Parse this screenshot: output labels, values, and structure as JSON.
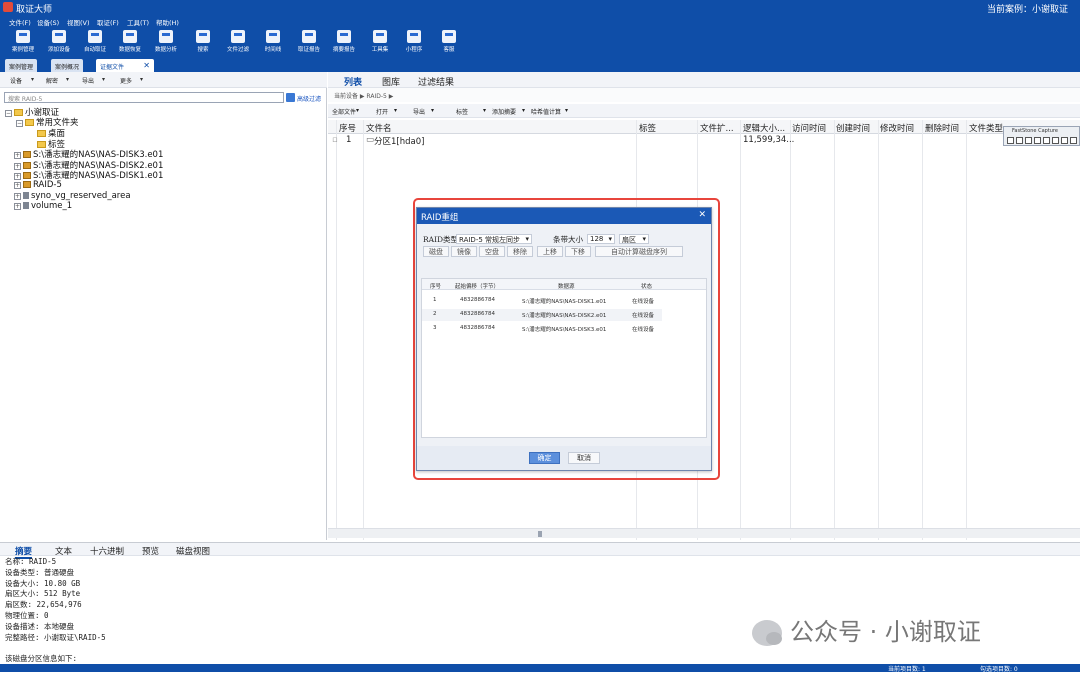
{
  "app": {
    "title": "取证大师",
    "current_case": "当前案例：小谢取证"
  },
  "menu": [
    "文件(F)",
    "设备(S)",
    "视图(V)",
    "取证(F)",
    "工具(T)",
    "帮助(H)"
  ],
  "ribbon": [
    "案例管理",
    "添加设备",
    "自动取证",
    "数据恢复",
    "数据分析",
    "搜索",
    "文件过滤",
    "时间线",
    "取证报告",
    "摘要报告",
    "工具集",
    "小程序",
    "客服"
  ],
  "doc_tabs": [
    "案例管理",
    "案例概况",
    "证据文件"
  ],
  "left": {
    "tool": [
      "设备",
      "解密",
      "导出",
      "更多"
    ],
    "search_placeholder": "搜索 RAID-5",
    "adv_filter": "高级过滤",
    "tree": {
      "root": "小谢取证",
      "common": "常用文件夹",
      "desktop": "桌面",
      "tags": "标签",
      "disk3": "S:\\潘志耀的NAS\\NAS-DISK3.e01",
      "disk2": "S:\\潘志耀的NAS\\NAS-DISK2.e01",
      "disk1": "S:\\潘志耀的NAS\\NAS-DISK1.e01",
      "raid": "RAID-5",
      "syno": "syno_vg_reserved_area",
      "volume": "volume_1"
    }
  },
  "right": {
    "tabs": [
      "列表",
      "图库",
      "过滤结果"
    ],
    "crumb": "当前设备 ▶ RAID-5 ▶",
    "tool": [
      "全部文件",
      "打开",
      "导出",
      "标签",
      "添加摘要",
      "哈希值计算"
    ],
    "columns": [
      "序号",
      "文件名",
      "标签",
      "文件扩...",
      "逻辑大小...",
      "访问时间",
      "创建时间",
      "修改时间",
      "删除时间",
      "文件类型"
    ],
    "row": {
      "index": "1",
      "name": "分区1[hda0]",
      "size": "11,599,34..."
    }
  },
  "faststone": "FastStone Capture",
  "dialog": {
    "title": "RAID重组",
    "raid_type_label": "RAID类型",
    "raid_type_value": "RAID-5 常规左同步",
    "stripe_label": "条带大小",
    "stripe_value": "128",
    "stripe_unit": "扇区",
    "buttons": [
      "磁盘",
      "镜像",
      "空盘",
      "移除",
      "上移",
      "下移",
      "自动计算磁盘序列"
    ],
    "columns": [
      "序号",
      "起始偏移（字节）",
      "数据源",
      "状态"
    ],
    "rows": [
      {
        "no": "1",
        "offset": "4832886784",
        "source": "S:\\潘志耀的NAS\\NAS-DISK1.e01",
        "status": "在线设备"
      },
      {
        "no": "2",
        "offset": "4832886784",
        "source": "S:\\潘志耀的NAS\\NAS-DISK2.e01",
        "status": "在线设备"
      },
      {
        "no": "3",
        "offset": "4832886784",
        "source": "S:\\潘志耀的NAS\\NAS-DISK3.e01",
        "status": "在线设备"
      }
    ],
    "ok": "确定",
    "cancel": "取消"
  },
  "bottom_tabs": [
    "摘要",
    "文本",
    "十六进制",
    "预览",
    "磁盘视图"
  ],
  "summary": [
    "名称: RAID-5",
    "设备类型: 普通硬盘",
    "设备大小: 10.80 GB",
    "扇区大小: 512 Byte",
    "扇区数: 22,654,976",
    "物理位置: 0",
    "设备描述: 本地硬盘",
    "完整路径: 小谢取证\\RAID-5",
    "",
    "该磁盘分区信息如下:"
  ],
  "status": {
    "left": "当前项目数: 1",
    "right": "勾选项目数: 0"
  },
  "watermark": "公众号 · 小谢取证",
  "colors": {
    "brand": "#0f4ea8",
    "highlight": "#e8453c",
    "ok_button": "#5b8fdc"
  }
}
